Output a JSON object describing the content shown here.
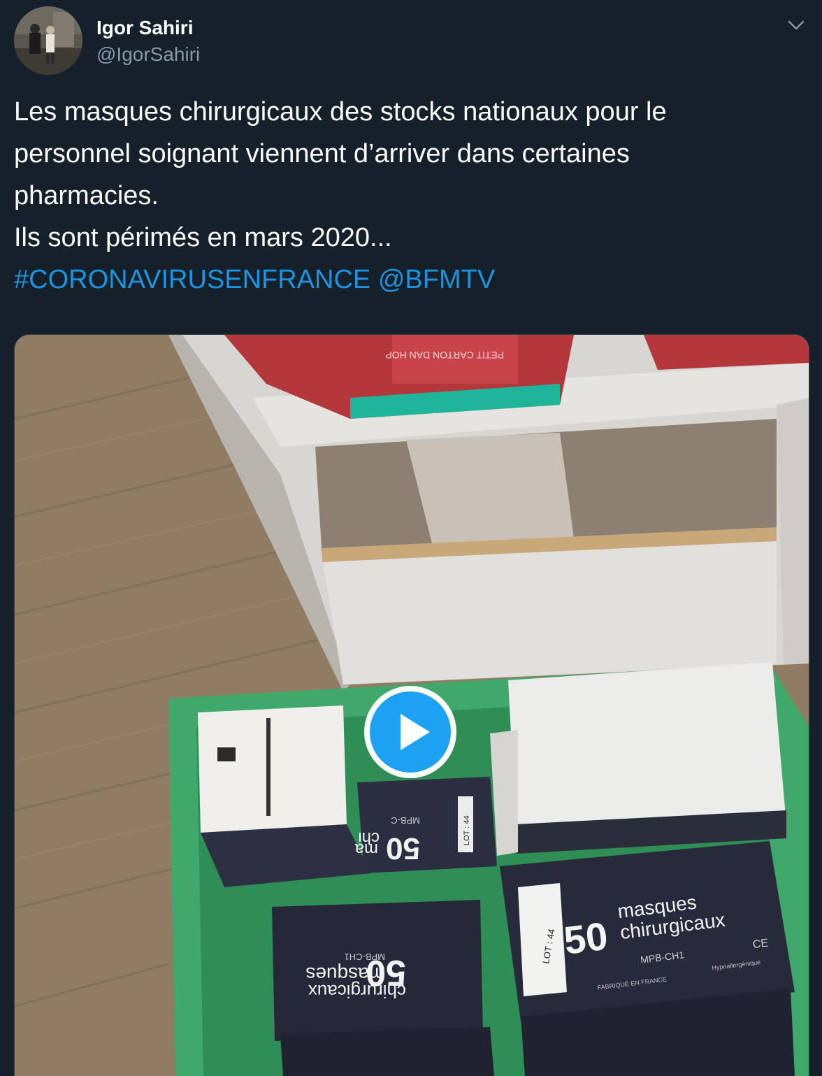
{
  "tweet": {
    "author": {
      "name": "Igor Sahiri",
      "handle": "@IgorSahiri"
    },
    "menu_icon": "chevron-down-icon",
    "text_lines": [
      "Les masques chirurgicaux des stocks nationaux pour le",
      "personnel soignant viennent d’arriver dans certaines",
      "pharmacies.",
      "Ils sont périmés en mars 2020..."
    ],
    "hashtag": "#CORONAVIRUSENFRANCE",
    "mention": "@BFMTV",
    "media": {
      "type": "video",
      "play_icon": "play-icon",
      "printed_text": {
        "box_front_count": "50",
        "box_front_line1": "masques",
        "box_front_line2": "chirurgicaux",
        "box_front_model": "MPB-CH1",
        "box_front_ce": "CE",
        "box_front_lot": "LOT : 44",
        "box_front_made": "FABRIQUÉ EN FRANCE",
        "box_front_hypo": "Hypoallergénique",
        "box_mid_count": "50",
        "box_mid_word": "ma",
        "box_mid_word2": "chi",
        "box_mid_lot": "LOT : 44",
        "box_mid_model": "MPB-C",
        "box_low_count": "50",
        "box_low_line1": "masques",
        "box_low_line2": "chirurgicaux",
        "box_low_model": "MPB-CH1"
      }
    }
  },
  "colors": {
    "background": "#15202b",
    "link": "#1b95e0",
    "secondary_text": "#8899a6",
    "play_button": "#1da1f2"
  }
}
